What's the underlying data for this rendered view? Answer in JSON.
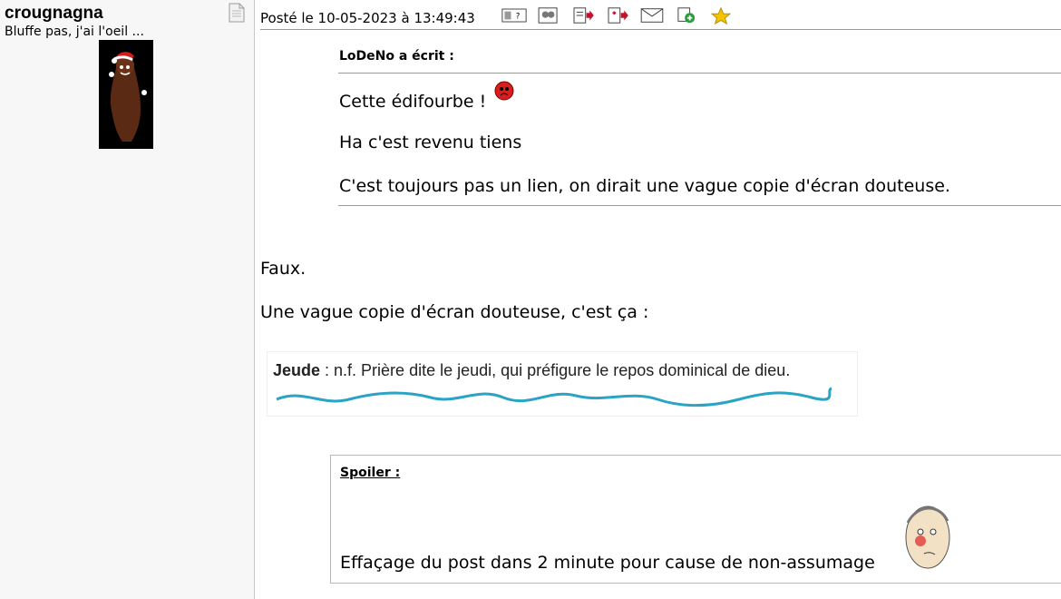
{
  "user": {
    "name": "crougnagna",
    "title": "Bluffe pas, j'ai l'oeil ..."
  },
  "post": {
    "date": "Posté le 10-05-2023 à 13:49:43",
    "quote": {
      "author": "LoDeNo a écrit :",
      "lines": [
        "Cette édifourbe !",
        "Ha c'est revenu tiens",
        "C'est toujours pas un lien, on dirait une vague copie d'écran douteuse."
      ]
    },
    "body": [
      "Faux.",
      "Une vague copie d'écran douteuse, c'est ça :"
    ],
    "screenshot": {
      "word": "Jeude",
      "text": " : n.f. Prière dite le jeudi, qui préfigure le repos dominical de dieu."
    },
    "spoiler": {
      "label": "Spoiler :",
      "text": "Effaçage du post dans 2 minute pour cause de non-assumage"
    }
  },
  "toolbar_icons": [
    "profile-icon",
    "quote-icon",
    "edit-icon",
    "answer-icon",
    "multi-quote-icon",
    "message-icon",
    "alert-icon",
    "favorite-star-icon"
  ],
  "colors": {
    "sidebar_bg": "#f7f7f7",
    "wave": "#2aa3c4",
    "star": "#f5c400"
  }
}
